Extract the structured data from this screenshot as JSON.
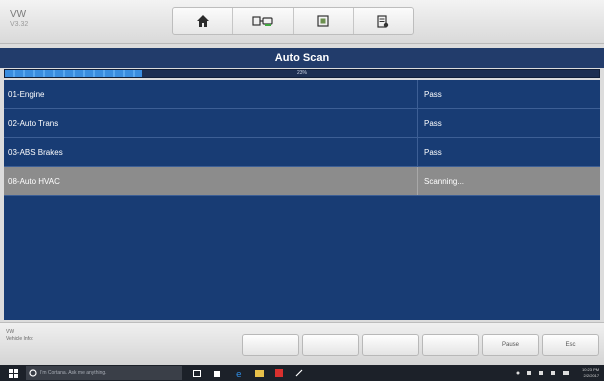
{
  "app": {
    "brand": "VW",
    "version": "V3.32"
  },
  "toolbar": {
    "buttons": [
      {
        "name": "home-icon"
      },
      {
        "name": "vehicle-connect-icon"
      },
      {
        "name": "screenshot-icon"
      },
      {
        "name": "data-manager-icon"
      }
    ]
  },
  "screen": {
    "title": "Auto Scan",
    "progress_percent": 23,
    "progress_label": "23%"
  },
  "results": [
    {
      "system": "01-Engine",
      "status": "Pass"
    },
    {
      "system": "02-Auto Trans",
      "status": "Pass"
    },
    {
      "system": "03-ABS Brakes",
      "status": "Pass"
    },
    {
      "system": "08-Auto HVAC",
      "status": "Scanning...",
      "selected": true
    }
  ],
  "footer": {
    "vehicle_line1": "VW",
    "vehicle_line2": "Vehicle Info:",
    "buttons": {
      "pause": "Pause",
      "esc": "Esc"
    }
  },
  "taskbar": {
    "search_placeholder": "I'm Cortana. Ask me anything.",
    "time": "10:23 PM",
    "date": "2/2/2017"
  },
  "colors": {
    "title_bar": "#223c6b",
    "list_bg": "#183c74",
    "selected_row": "#8c8c8c",
    "progress_fill": "#3b8ee0"
  }
}
